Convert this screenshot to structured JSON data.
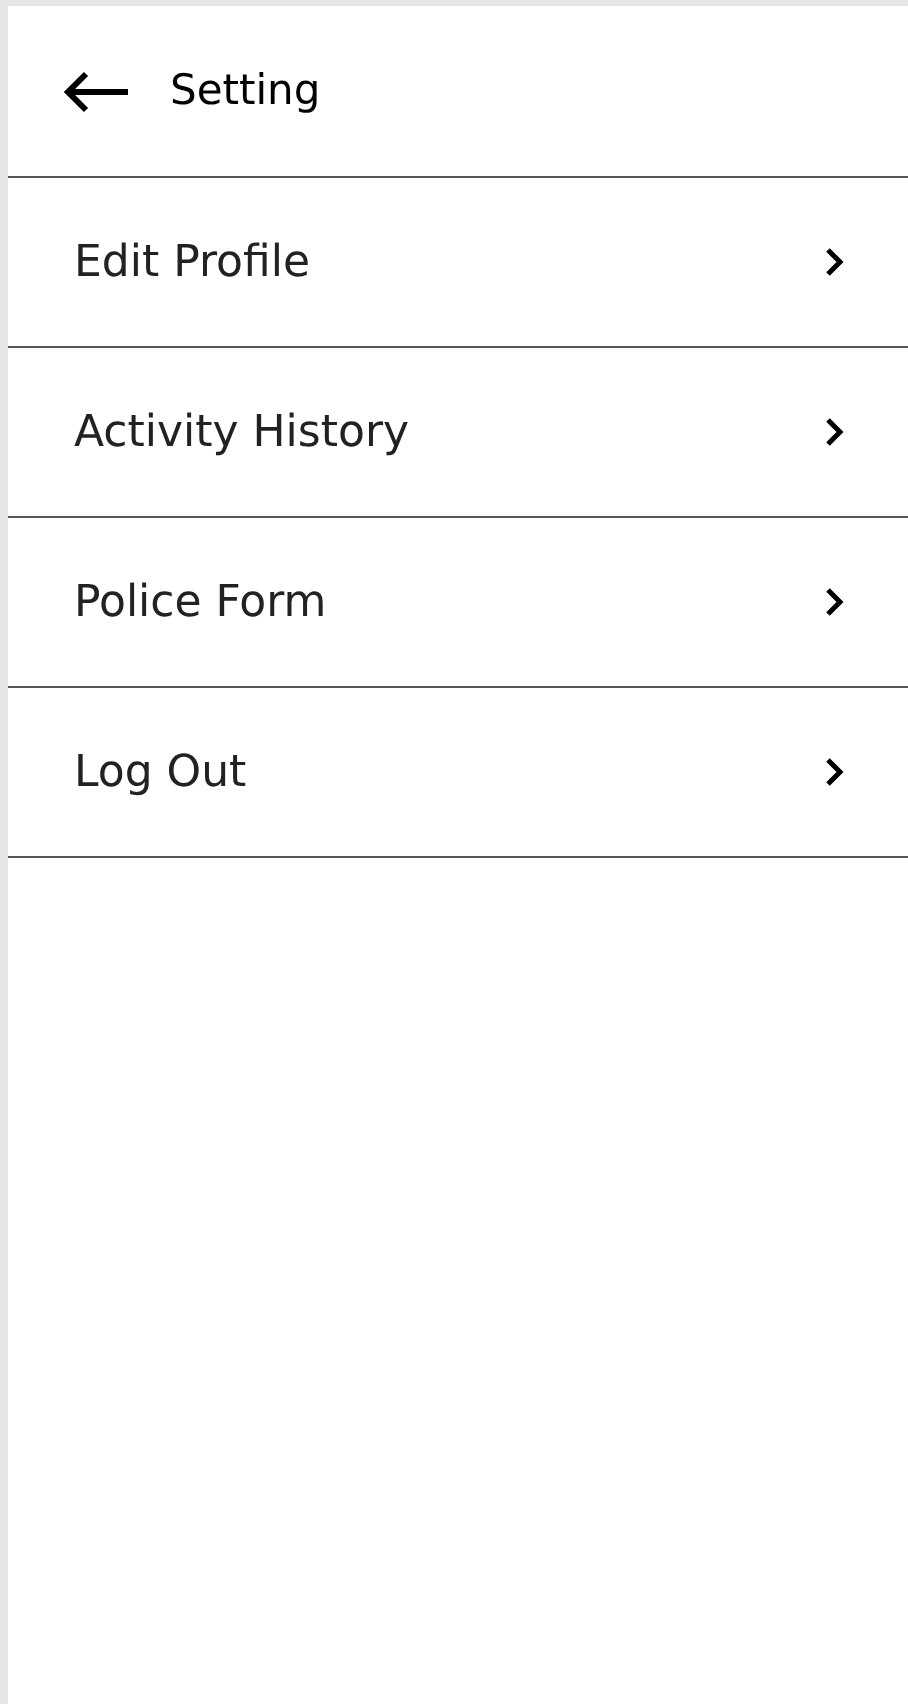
{
  "header": {
    "title": "Setting"
  },
  "items": [
    {
      "label": "Edit Profile"
    },
    {
      "label": "Activity History"
    },
    {
      "label": "Police Form"
    },
    {
      "label": "Log Out"
    }
  ]
}
